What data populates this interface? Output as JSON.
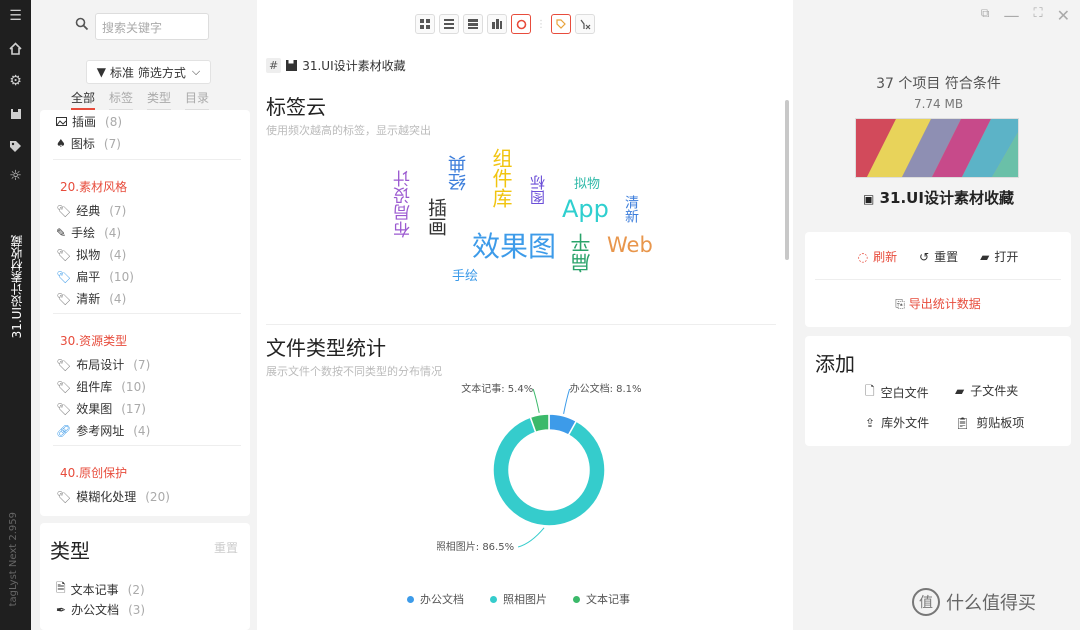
{
  "rail": {
    "vertical_label": "31.UI设计素材收藏",
    "version": "tagLyst Next 2.959"
  },
  "sidebar": {
    "search_placeholder": "搜索关键字",
    "filter_label": "标准 筛选方式",
    "tabs": [
      "全部",
      "标签",
      "类型",
      "目录"
    ],
    "tags_top": [
      {
        "label": "插画",
        "count": "(8)"
      },
      {
        "label": "图标",
        "count": "(7)"
      }
    ],
    "groups": [
      {
        "title": "20.素材风格",
        "items": [
          {
            "label": "经典",
            "count": "(7)"
          },
          {
            "label": "手绘",
            "count": "(4)"
          },
          {
            "label": "拟物",
            "count": "(4)"
          },
          {
            "label": "扁平",
            "count": "(10)"
          },
          {
            "label": "清新",
            "count": "(4)"
          }
        ]
      },
      {
        "title": "30.资源类型",
        "items": [
          {
            "label": "布局设计",
            "count": "(7)"
          },
          {
            "label": "组件库",
            "count": "(10)"
          },
          {
            "label": "效果图",
            "count": "(17)"
          },
          {
            "label": "参考网址",
            "count": "(4)"
          }
        ]
      },
      {
        "title": "40.原创保护",
        "items": [
          {
            "label": "模糊化处理",
            "count": "(20)"
          }
        ]
      }
    ],
    "type_section": {
      "title": "类型",
      "reset": "重置",
      "items": [
        {
          "label": "文本记事",
          "count": "(2)"
        },
        {
          "label": "办公文档",
          "count": "(3)"
        }
      ]
    }
  },
  "main": {
    "crumb_hash": "#",
    "crumb_label": "31.UI设计素材收藏",
    "tagcloud": {
      "title": "标签云",
      "subtitle": "使用频次越高的标签，显示越突出",
      "words": [
        "布局设计",
        "插画",
        "经典",
        "组件库",
        "图标",
        "拟物",
        "清新",
        "App",
        "效果图",
        "扁平",
        "Web",
        "手绘"
      ]
    },
    "filetypes": {
      "title": "文件类型统计",
      "subtitle": "展示文件个数按不同类型的分布情况"
    }
  },
  "chart_data": {
    "type": "pie",
    "donut": true,
    "categories": [
      "办公文档",
      "照相图片",
      "文本记事"
    ],
    "values": [
      8.1,
      86.5,
      5.4
    ],
    "labels": [
      "办公文档: 8.1%",
      "照相图片: 86.5%",
      "文本记事: 5.4%"
    ],
    "colors": [
      "#3d9be9",
      "#35cccc",
      "#3bb96a"
    ],
    "legend": "bottom"
  },
  "right": {
    "summary": "37 个项目 符合条件",
    "size": "7.74 MB",
    "folder_name": "31.UI设计素材收藏",
    "actions": [
      "刷新",
      "重置",
      "打开"
    ],
    "export": "导出统计数据",
    "add": {
      "title": "添加",
      "items": [
        "空白文件",
        "子文件夹",
        "库外文件",
        "剪贴板项"
      ]
    }
  },
  "watermark": {
    "glyph": "值",
    "text": "什么值得买"
  },
  "colors": {
    "accent": "#e74c3c",
    "rail": "#1f1f1f"
  }
}
